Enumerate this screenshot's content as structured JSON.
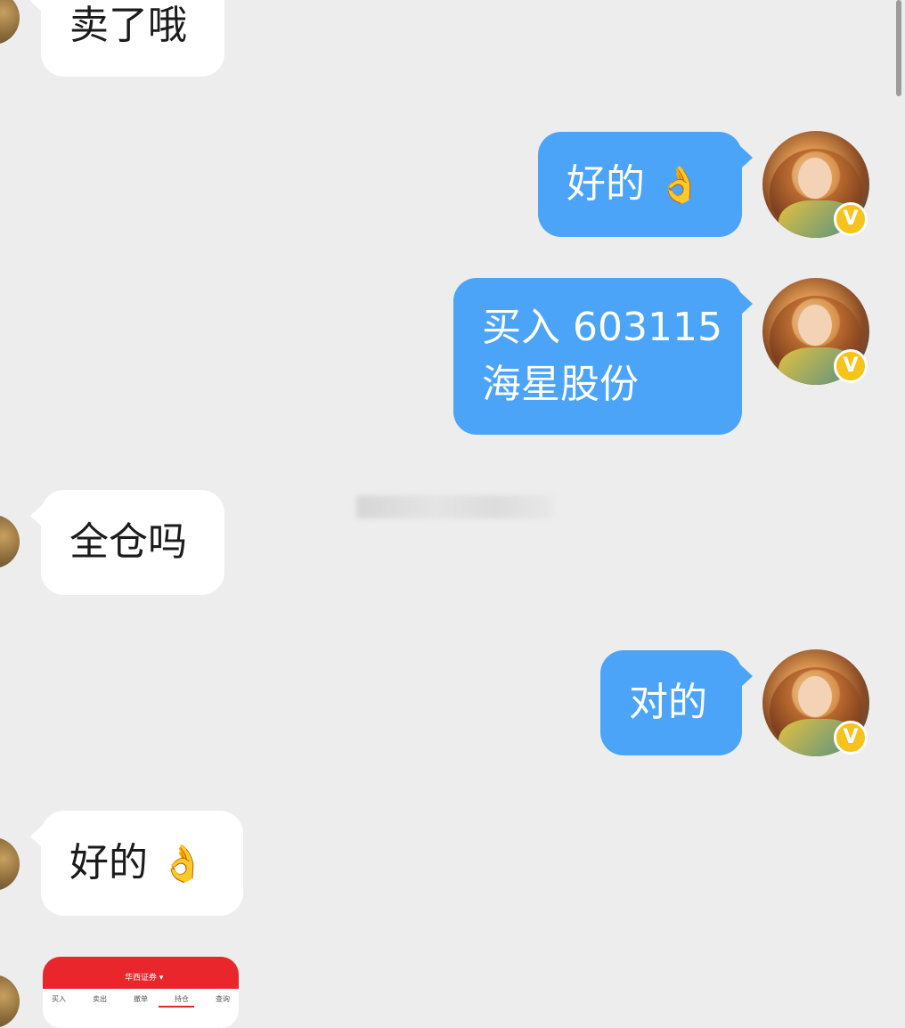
{
  "messages": [
    {
      "side": "in",
      "text": "卖了哦"
    },
    {
      "side": "out",
      "text": "好的"
    },
    {
      "side": "out",
      "lines": [
        "买入 603115",
        "海星股份"
      ]
    },
    {
      "side": "in",
      "text": "全仓吗"
    },
    {
      "side": "out",
      "text": "对的"
    },
    {
      "side": "in",
      "text": "好的"
    }
  ],
  "emoji": {
    "ok_hand": "👌"
  },
  "badge": {
    "verified_letter": "V"
  },
  "thumbnail": {
    "title": "华西证券 ▾",
    "tabs": [
      "买入",
      "卖出",
      "撤单",
      "持仓",
      "查询"
    ]
  },
  "colors": {
    "background": "#ededed",
    "outgoing_bubble": "#4ba4f7",
    "incoming_bubble": "#ffffff",
    "badge": "#f6c31a"
  },
  "icons": {
    "verified_badge": "verified-badge-icon",
    "ok_hand": "ok-hand-emoji"
  }
}
